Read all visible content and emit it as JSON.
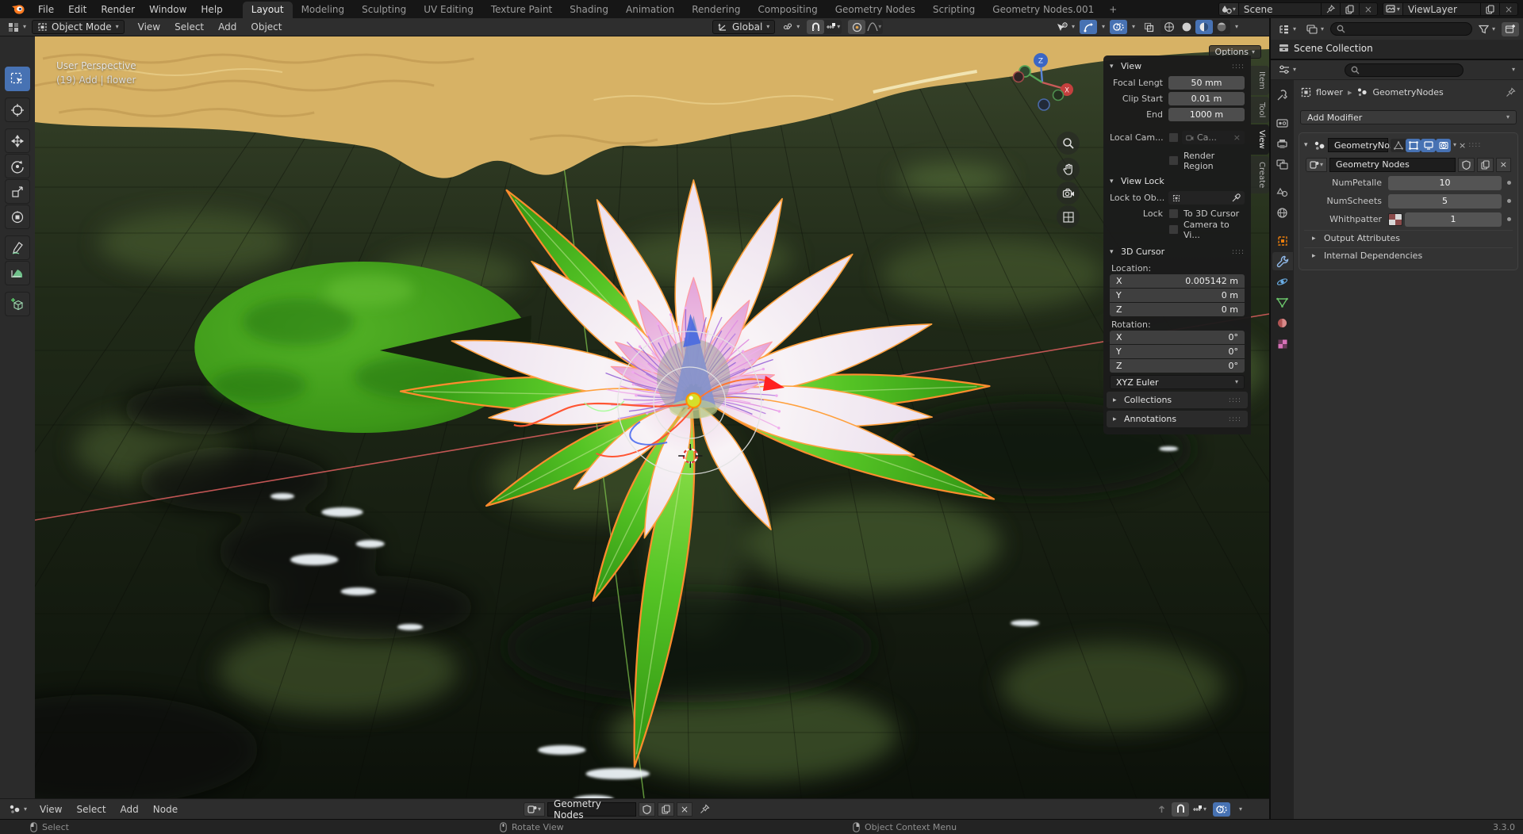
{
  "topbar": {
    "menus": [
      "File",
      "Edit",
      "Render",
      "Window",
      "Help"
    ],
    "workspaces": [
      "Layout",
      "Modeling",
      "Sculpting",
      "UV Editing",
      "Texture Paint",
      "Shading",
      "Animation",
      "Rendering",
      "Compositing",
      "Geometry Nodes",
      "Scripting",
      "Geometry Nodes.001"
    ],
    "active_workspace": "Layout",
    "new_workspace_label": "+",
    "scene_label": "Scene",
    "viewlayer_label": "ViewLayer"
  },
  "viewport_header": {
    "mode": "Object Mode",
    "menus": [
      "View",
      "Select",
      "Add",
      "Object"
    ],
    "orientation": "Global",
    "options_label": "Options"
  },
  "viewport": {
    "perspective_label": "User Perspective",
    "operator_hint": "(19) Add | flower",
    "gizmo_z_label": "Z",
    "gizmo_x_label": "X"
  },
  "sidebar": {
    "tabs": [
      "Item",
      "Tool",
      "View",
      "Create"
    ],
    "active_tab": "View",
    "view": {
      "title": "View",
      "rows": [
        {
          "label": "Focal Lengt",
          "value": "50 mm"
        },
        {
          "label": "Clip Start",
          "value": "0.01 m"
        },
        {
          "label": "End",
          "value": "1000 m"
        }
      ],
      "local_camera_label": "Local Cam...",
      "local_camera_value": "Ca...",
      "render_region_label": "Render Region"
    },
    "view_lock": {
      "title": "View Lock",
      "lock_to_label": "Lock to Ob...",
      "lock_label": "Lock",
      "to_3d_cursor_label": "To 3D Cursor",
      "camera_to_view_label": "Camera to Vi..."
    },
    "cursor": {
      "title": "3D Cursor",
      "location_label": "Location:",
      "location_rows": [
        {
          "axis": "X",
          "value": "0.005142 m"
        },
        {
          "axis": "Y",
          "value": "0 m"
        },
        {
          "axis": "Z",
          "value": "0 m"
        }
      ],
      "rotation_label": "Rotation:",
      "rotation_rows": [
        {
          "axis": "X",
          "value": "0°"
        },
        {
          "axis": "Y",
          "value": "0°"
        },
        {
          "axis": "Z",
          "value": "0°"
        }
      ],
      "euler_mode": "XYZ Euler"
    },
    "collections_title": "Collections",
    "annotations_title": "Annotations"
  },
  "outliner": {
    "scene_collection_label": "Scene Collection"
  },
  "properties": {
    "breadcrumb": {
      "object": "flower",
      "node_group": "GeometryNodes"
    },
    "add_modifier_label": "Add Modifier",
    "modifier": {
      "name": "GeometryNo...",
      "node_group_name": "Geometry Nodes",
      "inputs": [
        {
          "label": "NumPetalle",
          "value": "10"
        },
        {
          "label": "NumScheets",
          "value": "5"
        },
        {
          "label": "Whithpatter",
          "value": "1"
        }
      ],
      "subpanels": [
        "Output Attributes",
        "Internal Dependencies"
      ]
    }
  },
  "node_editor": {
    "menus": [
      "View",
      "Select",
      "Add",
      "Node"
    ],
    "node_group_name": "Geometry Nodes"
  },
  "status_bar": {
    "left_hint": "Select",
    "middle_hint": "Rotate View",
    "right_hint": "Object Context Menu",
    "version": "3.3.0"
  },
  "colors": {
    "accent": "#4772b3",
    "selection_outline": "#ff8c2e"
  }
}
